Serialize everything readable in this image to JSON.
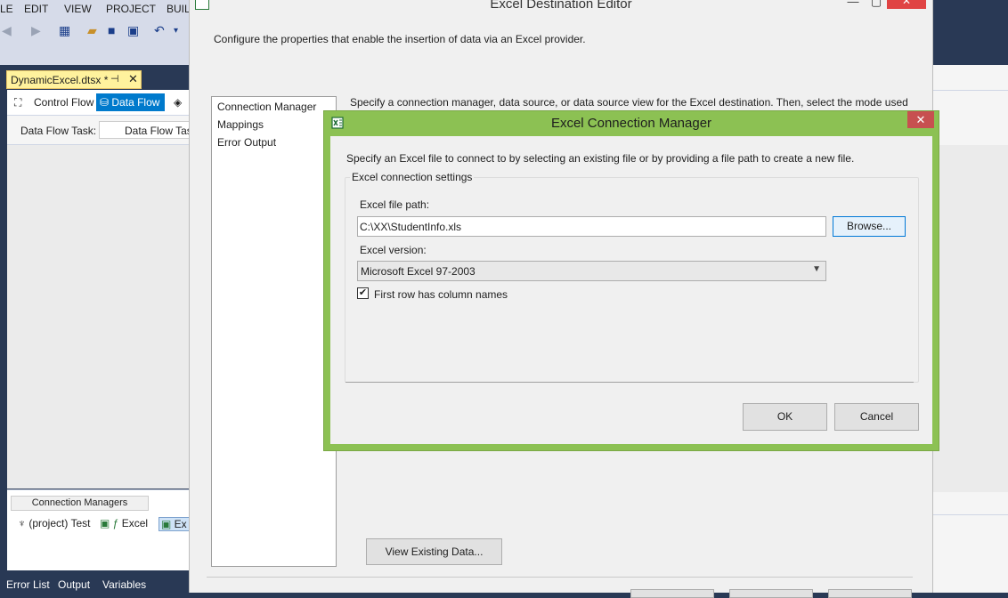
{
  "vs": {
    "menu": [
      "LE",
      "EDIT",
      "VIEW",
      "PROJECT",
      "BUIL"
    ],
    "doc_tab": {
      "label": "DynamicExcel.dtsx *",
      "pin": "⊣",
      "close": "✕"
    },
    "designer_tabs": {
      "control_flow": "Control Flow",
      "data_flow": "Data Flow"
    },
    "task_row": {
      "label": "Data Flow Task:",
      "value": "Data Flow Tas"
    },
    "connection_managers": {
      "title": "Connection Managers",
      "items": [
        "(project) Test",
        "Excel",
        "Ex"
      ]
    },
    "bottom_tabs": [
      "Error List",
      "Output",
      "Variables"
    ]
  },
  "editor": {
    "title": "Excel Destination Editor",
    "description": "Configure the properties that enable the insertion of data via an Excel provider.",
    "nav": [
      "Connection Manager",
      "Mappings",
      "Error Output"
    ],
    "right_text": "Specify a connection manager, data source, or data source view for the Excel destination. Then, select the mode used",
    "view_data_label": "View Existing Data...",
    "close_label": "✕"
  },
  "dialog": {
    "title": "Excel Connection Manager",
    "close_label": "✕",
    "description": "Specify an Excel file to connect to by selecting an existing file or by providing a file path to create a new file.",
    "group_label": "Excel connection settings",
    "file_path_label": "Excel file path:",
    "file_path_value": "C:\\XX\\StudentInfo.xls",
    "browse_label": "Browse...",
    "version_label": "Excel version:",
    "version_value": "Microsoft Excel 97-2003",
    "first_row_label": "First row has column names",
    "first_row_checked": true,
    "ok_label": "OK",
    "cancel_label": "Cancel"
  },
  "colors": {
    "vs_chrome": "#293955",
    "data_flow_tab": "#007acc",
    "dialog_frame": "#8cc153",
    "dialog_close": "#c75050",
    "doc_tab": "#fff29d"
  }
}
